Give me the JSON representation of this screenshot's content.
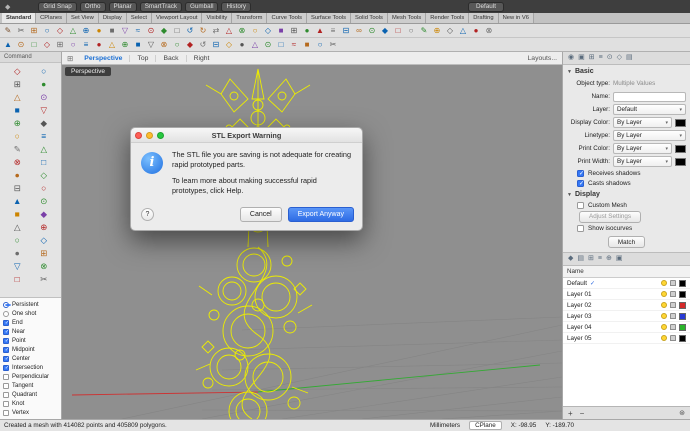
{
  "titlebar": {
    "buttons": [
      "Grid Snap",
      "Ortho",
      "Planar",
      "SmartTrack",
      "Gumball",
      "History"
    ],
    "default_label": "Default"
  },
  "tabs": [
    "Standard",
    "CPlanes",
    "Set View",
    "Display",
    "Select",
    "Viewport Layout",
    "Visibility",
    "Transform",
    "Curve Tools",
    "Surface Tools",
    "Solid Tools",
    "Mesh Tools",
    "Render Tools",
    "Drafting",
    "New in V6"
  ],
  "icons": {
    "row1": [
      [
        "✎",
        "#7a5230"
      ],
      [
        "✂",
        "#555555"
      ],
      [
        "⊞",
        "#b56a1e"
      ],
      [
        "○",
        "#0a62b0"
      ],
      [
        "◇",
        "#b22222"
      ],
      [
        "△",
        "#2e8b2e"
      ],
      [
        "⊕",
        "#0a62b0"
      ],
      [
        "●",
        "#cc8400"
      ],
      [
        "■",
        "#6d6d6d"
      ],
      [
        "▽",
        "#7a3fa8"
      ],
      [
        "≈",
        "#0a62b0"
      ],
      [
        "⊙",
        "#b22222"
      ],
      [
        "◆",
        "#2e8b2e"
      ],
      [
        "□",
        "#555555"
      ],
      [
        "↺",
        "#0a62b0"
      ],
      [
        "↻",
        "#b56a1e"
      ],
      [
        "⇄",
        "#6d6d6d"
      ],
      [
        "△",
        "#b22222"
      ],
      [
        "⊗",
        "#2e8b2e"
      ],
      [
        "○",
        "#cc8400"
      ],
      [
        "◇",
        "#0a62b0"
      ],
      [
        "■",
        "#7a3fa8"
      ],
      [
        "⊞",
        "#555555"
      ],
      [
        "●",
        "#2e8b2e"
      ],
      [
        "▲",
        "#b22222"
      ],
      [
        "≡",
        "#6d6d6d"
      ],
      [
        "⊟",
        "#0a62b0"
      ],
      [
        "∞",
        "#b56a1e"
      ],
      [
        "⊙",
        "#2e8b2e"
      ],
      [
        "◆",
        "#0a62b0"
      ],
      [
        "□",
        "#b22222"
      ],
      [
        "○",
        "#6d6d6d"
      ],
      [
        "✎",
        "#2e8b2e"
      ],
      [
        "⊕",
        "#cc8400"
      ],
      [
        "◇",
        "#555555"
      ],
      [
        "△",
        "#0a62b0"
      ],
      [
        "●",
        "#b22222"
      ],
      [
        "⊗",
        "#6d6d6d"
      ]
    ],
    "row2": [
      [
        "▲",
        "#0a62b0"
      ],
      [
        "⊙",
        "#b56a1e"
      ],
      [
        "□",
        "#2e8b2e"
      ],
      [
        "◇",
        "#b22222"
      ],
      [
        "⊞",
        "#6d6d6d"
      ],
      [
        "○",
        "#7a3fa8"
      ],
      [
        "≡",
        "#0a62b0"
      ],
      [
        "●",
        "#b22222"
      ],
      [
        "△",
        "#cc8400"
      ],
      [
        "⊕",
        "#2e8b2e"
      ],
      [
        "■",
        "#0a62b0"
      ],
      [
        "▽",
        "#555555"
      ],
      [
        "⊗",
        "#b56a1e"
      ],
      [
        "○",
        "#2e8b2e"
      ],
      [
        "◆",
        "#b22222"
      ],
      [
        "↺",
        "#6d6d6d"
      ],
      [
        "⊟",
        "#0a62b0"
      ],
      [
        "◇",
        "#cc8400"
      ],
      [
        "●",
        "#555555"
      ],
      [
        "△",
        "#7a3fa8"
      ],
      [
        "⊙",
        "#2e8b2e"
      ],
      [
        "□",
        "#0a62b0"
      ],
      [
        "≈",
        "#b22222"
      ],
      [
        "■",
        "#b56a1e"
      ],
      [
        "○",
        "#0a62b0"
      ],
      [
        "✂",
        "#555555"
      ]
    ],
    "palette": [
      [
        "◇",
        "#b22222"
      ],
      [
        "○",
        "#0a62b0"
      ],
      [
        "⊞",
        "#555555"
      ],
      [
        "●",
        "#2e8b2e"
      ],
      [
        "△",
        "#b56a1e"
      ],
      [
        "⊙",
        "#7a3fa8"
      ],
      [
        "■",
        "#0a62b0"
      ],
      [
        "▽",
        "#b22222"
      ],
      [
        "⊕",
        "#2e8b2e"
      ],
      [
        "◆",
        "#555555"
      ],
      [
        "○",
        "#cc8400"
      ],
      [
        "≡",
        "#0a62b0"
      ],
      [
        "✎",
        "#6d6d6d"
      ],
      [
        "△",
        "#2e8b2e"
      ],
      [
        "⊗",
        "#b22222"
      ],
      [
        "□",
        "#0a62b0"
      ],
      [
        "●",
        "#b56a1e"
      ],
      [
        "◇",
        "#2e8b2e"
      ],
      [
        "⊟",
        "#555555"
      ],
      [
        "○",
        "#b22222"
      ],
      [
        "▲",
        "#0a62b0"
      ],
      [
        "⊙",
        "#2e8b2e"
      ],
      [
        "■",
        "#cc8400"
      ],
      [
        "◆",
        "#7a3fa8"
      ],
      [
        "△",
        "#555555"
      ],
      [
        "⊕",
        "#b22222"
      ],
      [
        "○",
        "#2e8b2e"
      ],
      [
        "◇",
        "#0a62b0"
      ],
      [
        "●",
        "#6d6d6d"
      ],
      [
        "⊞",
        "#b56a1e"
      ],
      [
        "▽",
        "#0a62b0"
      ],
      [
        "⊗",
        "#2e8b2e"
      ],
      [
        "□",
        "#b22222"
      ],
      [
        "✂",
        "#555555"
      ]
    ],
    "properties_tabs": [
      "◉",
      "▣",
      "⊞",
      "≡",
      "⊙",
      "◇",
      "▤"
    ],
    "layers_tabs": [
      "◆",
      "▤",
      "⊞",
      "≡",
      "⊕",
      "▣"
    ]
  },
  "sidebar": {
    "command_label": "Command"
  },
  "viewport": {
    "tabs": [
      "Perspective",
      "Top",
      "Back",
      "Right"
    ],
    "active": "Perspective",
    "layouts_label": "Layouts...",
    "badge": "Perspective"
  },
  "dialog": {
    "title": "STL Export Warning",
    "message_1": "The STL file you are saving is not adequate for creating rapid prototyped parts.",
    "message_2": "To learn more about making successful rapid prototypes, click Help.",
    "help_label": "?",
    "cancel_label": "Cancel",
    "export_label": "Export Anyway"
  },
  "properties": {
    "section_basic": "Basic",
    "object_type_label": "Object type:",
    "object_type_value": "Multiple Values",
    "name_label": "Name:",
    "layer_label": "Layer:",
    "layer_value": "Default",
    "display_color_label": "Display Color:",
    "display_color_value": "By Layer",
    "linetype_label": "Linetype:",
    "linetype_value": "By Layer",
    "print_color_label": "Print Color:",
    "print_color_value": "By Layer",
    "print_width_label": "Print Width:",
    "print_width_value": "By Layer",
    "receives_shadows": "Receives shadows",
    "casts_shadows": "Casts shadows",
    "section_display": "Display",
    "custom_mesh": "Custom Mesh",
    "adjust_settings": "Adjust Settings",
    "show_isocurves": "Show isocurves",
    "match_label": "Match"
  },
  "layers": {
    "header": "Name",
    "rows": [
      {
        "name": "Default",
        "current": true,
        "color": "#000000"
      },
      {
        "name": "Layer 01",
        "current": false,
        "color": "#000000"
      },
      {
        "name": "Layer 02",
        "current": false,
        "color": "#d42a2a"
      },
      {
        "name": "Layer 03",
        "current": false,
        "color": "#2a3ad4"
      },
      {
        "name": "Layer 04",
        "current": false,
        "color": "#2ab42a"
      },
      {
        "name": "Layer 05",
        "current": false,
        "color": "#000000"
      }
    ],
    "add_label": "+",
    "remove_label": "−",
    "settings_icon": "⊛"
  },
  "osnap": {
    "items": [
      {
        "label": "Persistent",
        "checked": true,
        "radio": true
      },
      {
        "label": "One shot",
        "checked": false,
        "radio": true
      },
      {
        "label": "End",
        "checked": true
      },
      {
        "label": "Near",
        "checked": true
      },
      {
        "label": "Point",
        "checked": true
      },
      {
        "label": "Midpoint",
        "checked": true
      },
      {
        "label": "Center",
        "checked": true
      },
      {
        "label": "Intersection",
        "checked": true
      },
      {
        "label": "Perpendicular",
        "checked": false
      },
      {
        "label": "Tangent",
        "checked": false
      },
      {
        "label": "Quadrant",
        "checked": false
      },
      {
        "label": "Knot",
        "checked": false
      },
      {
        "label": "Vertex",
        "checked": false
      }
    ]
  },
  "status": {
    "message": "Created a mesh with 414082 points and 405809 polygons.",
    "units": "Millimeters",
    "cplane": "CPlane",
    "x": "X: -98.95",
    "y": "Y: -189.70"
  }
}
